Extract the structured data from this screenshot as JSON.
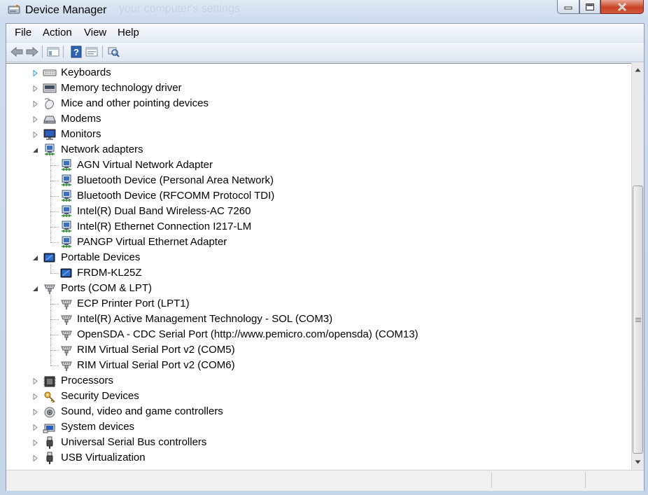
{
  "window": {
    "title": "Device Manager",
    "background_text": "your computer's settings"
  },
  "menu": [
    "File",
    "Action",
    "View",
    "Help"
  ],
  "toolbar": {
    "buttons": [
      "back-icon",
      "forward-icon",
      "show-hide-console-tree-icon",
      "help-icon",
      "properties-icon",
      "scan-hardware-icon"
    ]
  },
  "tree": [
    {
      "label": "Keyboards",
      "level": 1,
      "expander": "collapsed-hover",
      "icon": "keyboard-icon"
    },
    {
      "label": "Memory technology driver",
      "level": 1,
      "expander": "collapsed",
      "icon": "memory-card-icon"
    },
    {
      "label": "Mice and other pointing devices",
      "level": 1,
      "expander": "collapsed",
      "icon": "mouse-icon"
    },
    {
      "label": "Modems",
      "level": 1,
      "expander": "collapsed",
      "icon": "modem-icon"
    },
    {
      "label": "Monitors",
      "level": 1,
      "expander": "collapsed",
      "icon": "monitor-icon"
    },
    {
      "label": "Network adapters",
      "level": 1,
      "expander": "expanded",
      "icon": "network-adapter-icon"
    },
    {
      "label": "AGN Virtual Network Adapter",
      "level": 2,
      "icon": "network-adapter-icon"
    },
    {
      "label": "Bluetooth Device (Personal Area Network)",
      "level": 2,
      "icon": "network-adapter-icon"
    },
    {
      "label": "Bluetooth Device (RFCOMM Protocol TDI)",
      "level": 2,
      "icon": "network-adapter-icon"
    },
    {
      "label": "Intel(R) Dual Band Wireless-AC 7260",
      "level": 2,
      "icon": "network-adapter-icon"
    },
    {
      "label": "Intel(R) Ethernet Connection I217-LM",
      "level": 2,
      "icon": "network-adapter-icon"
    },
    {
      "label": "PANGP Virtual Ethernet Adapter",
      "level": 2,
      "icon": "network-adapter-icon"
    },
    {
      "label": "Portable Devices",
      "level": 1,
      "expander": "expanded",
      "icon": "portable-device-icon"
    },
    {
      "label": "FRDM-KL25Z",
      "level": 2,
      "icon": "portable-device-icon"
    },
    {
      "label": "Ports (COM & LPT)",
      "level": 1,
      "expander": "expanded",
      "icon": "port-icon"
    },
    {
      "label": "ECP Printer Port (LPT1)",
      "level": 2,
      "icon": "port-icon"
    },
    {
      "label": "Intel(R) Active Management Technology - SOL (COM3)",
      "level": 2,
      "icon": "port-icon"
    },
    {
      "label": "OpenSDA - CDC Serial Port (http://www.pemicro.com/opensda) (COM13)",
      "level": 2,
      "icon": "port-icon"
    },
    {
      "label": "RIM Virtual Serial Port v2 (COM5)",
      "level": 2,
      "icon": "port-icon"
    },
    {
      "label": "RIM Virtual Serial Port v2 (COM6)",
      "level": 2,
      "icon": "port-icon"
    },
    {
      "label": "Processors",
      "level": 1,
      "expander": "collapsed",
      "icon": "processor-icon"
    },
    {
      "label": "Security Devices",
      "level": 1,
      "expander": "collapsed",
      "icon": "security-key-icon"
    },
    {
      "label": "Sound, video and game controllers",
      "level": 1,
      "expander": "collapsed",
      "icon": "speaker-icon"
    },
    {
      "label": "System devices",
      "level": 1,
      "expander": "collapsed",
      "icon": "system-device-icon"
    },
    {
      "label": "Universal Serial Bus controllers",
      "level": 1,
      "expander": "collapsed",
      "icon": "usb-icon"
    },
    {
      "label": "USB Virtualization",
      "level": 1,
      "expander": "collapsed",
      "icon": "usb-icon"
    }
  ],
  "statusbar": {
    "text": ""
  }
}
